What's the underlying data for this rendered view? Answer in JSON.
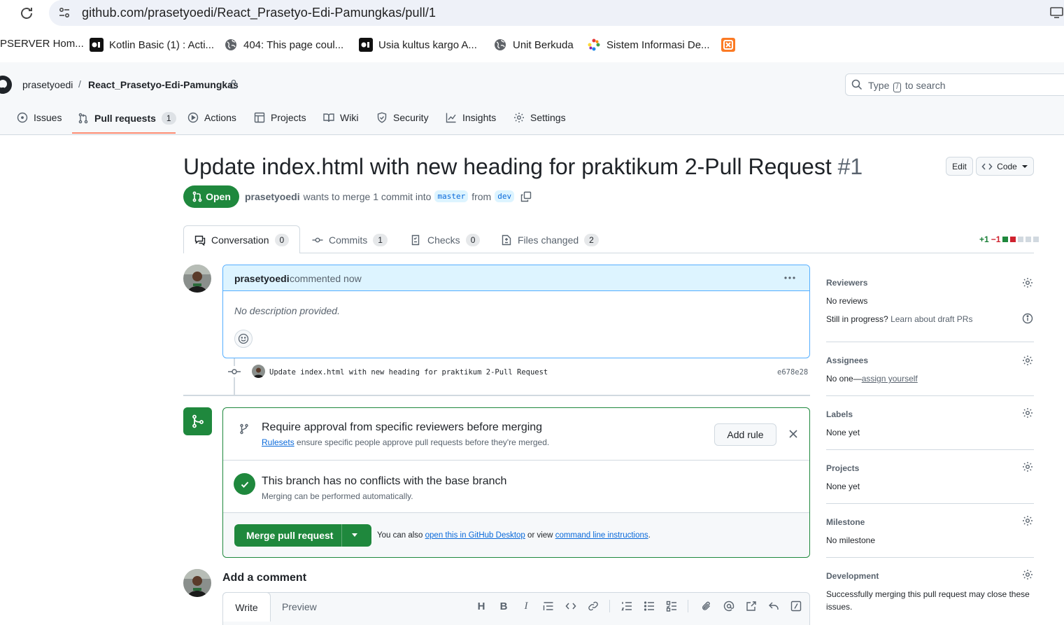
{
  "browser": {
    "url": "github.com/prasetyoedi/React_Prasetyo-Edi-Pamungkas/pull/1",
    "bookmarks": [
      {
        "label": "PSERVER Hom...",
        "icon": "none"
      },
      {
        "label": "Kotlin Basic (1) : Acti...",
        "icon": "dicoding-icon"
      },
      {
        "label": "404: This page coul...",
        "icon": "globe-icon"
      },
      {
        "label": "Usia kultus kargo A...",
        "icon": "dicoding-icon"
      },
      {
        "label": "Unit Berkuda",
        "icon": "globe-icon"
      },
      {
        "label": "Sistem Informasi De...",
        "icon": "flower-icon"
      },
      {
        "label": "",
        "icon": "xampp-icon"
      }
    ]
  },
  "header": {
    "owner": "prasetyoedi",
    "separator": "/",
    "repo": "React_Prasetyo-Edi-Pamungkas",
    "search_prefix": "Type",
    "search_key": "/",
    "search_suffix": "to search"
  },
  "nav": {
    "tabs": [
      {
        "label": "Issues",
        "icon": "issue-icon"
      },
      {
        "label": "Pull requests",
        "icon": "pull-request-icon",
        "count": "1",
        "active": true
      },
      {
        "label": "Actions",
        "icon": "play-icon"
      },
      {
        "label": "Projects",
        "icon": "table-icon"
      },
      {
        "label": "Wiki",
        "icon": "book-icon"
      },
      {
        "label": "Security",
        "icon": "shield-icon"
      },
      {
        "label": "Insights",
        "icon": "graph-icon"
      },
      {
        "label": "Settings",
        "icon": "gear-icon"
      }
    ]
  },
  "pr": {
    "title": "Update index.html with new heading for praktikum 2-Pull Request",
    "number": "#1",
    "edit_label": "Edit",
    "code_label": "Code",
    "state": "Open",
    "author": "prasetyoedi",
    "meta_text": "wants to merge 1 commit into",
    "base_branch": "master",
    "from_text": "from",
    "head_branch": "dev"
  },
  "pr_tabs": [
    {
      "label": "Conversation",
      "count": "0",
      "icon": "comment-icon"
    },
    {
      "label": "Commits",
      "count": "1",
      "icon": "commit-icon"
    },
    {
      "label": "Checks",
      "count": "0",
      "icon": "checklist-icon"
    },
    {
      "label": "Files changed",
      "count": "2",
      "icon": "file-diff-icon"
    }
  ],
  "diffstat": {
    "additions": "+1",
    "deletions": "−1"
  },
  "comment": {
    "author": "prasetyoedi",
    "time": "commented now",
    "body": "No description provided."
  },
  "commit": {
    "message": "Update index.html with new heading for praktikum 2-Pull Request",
    "sha": "e678e28"
  },
  "merge": {
    "rule_title": "Require approval from specific reviewers before merging",
    "rule_link": "Rulesets",
    "rule_sub": "ensure specific people approve pull requests before they're merged.",
    "add_rule_label": "Add rule",
    "conflict_title": "This branch has no conflicts with the base branch",
    "conflict_sub": "Merging can be performed automatically.",
    "merge_button": "Merge pull request",
    "alt_prefix": "You can also",
    "alt_link1": "open this in GitHub Desktop",
    "alt_middle": "or view",
    "alt_link2": "command line instructions",
    "alt_suffix": "."
  },
  "composer": {
    "title": "Add a comment",
    "write_tab": "Write",
    "preview_tab": "Preview"
  },
  "sidebar": {
    "reviewers": {
      "title": "Reviewers",
      "value": "No reviews",
      "hint": "Still in progress?",
      "hint_link": "Learn about draft PRs"
    },
    "assignees": {
      "title": "Assignees",
      "value": "No one—",
      "link": "assign yourself"
    },
    "labels": {
      "title": "Labels",
      "value": "None yet"
    },
    "projects": {
      "title": "Projects",
      "value": "None yet"
    },
    "milestone": {
      "title": "Milestone",
      "value": "No milestone"
    },
    "development": {
      "title": "Development",
      "value_line1": "Successfully merging this pull request may close these",
      "value_line2": "issues."
    }
  },
  "colors": {
    "accent_green": "#1f883d",
    "link_blue": "#0969da",
    "tab_underline": "#fd8c73",
    "deletion_red": "#cf222e"
  }
}
